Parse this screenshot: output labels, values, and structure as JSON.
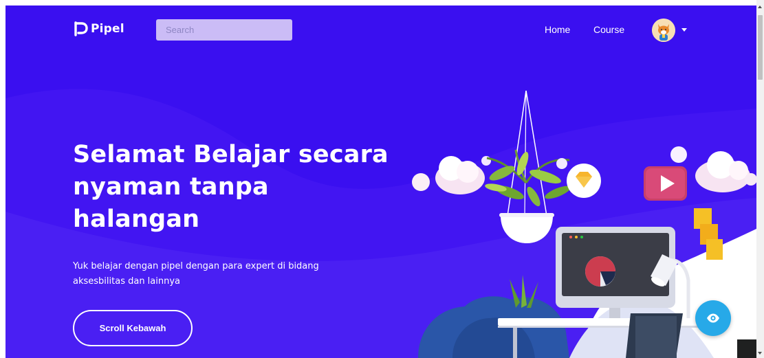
{
  "navbar": {
    "brand": "Pipel",
    "search_placeholder": "Search",
    "links": [
      {
        "label": "Home"
      },
      {
        "label": "Course"
      }
    ],
    "avatar_icon": "fox-avatar",
    "dropdown_icon": "caret-down-icon"
  },
  "hero": {
    "title": "Selamat Belajar secara nyaman tanpa halangan",
    "subtitle": "Yuk belajar dengan pipel dengan para expert di bidang aksesbilitas dan lainnya",
    "cta_label": "Scroll Kebawah"
  },
  "floating": {
    "accessibility_icon": "eye-icon"
  },
  "colors": {
    "hero_bg": "#3a0ff0",
    "search_bg": "#cbbcf6",
    "accessibility_btn": "#27a9e8",
    "text": "#ffffff"
  }
}
